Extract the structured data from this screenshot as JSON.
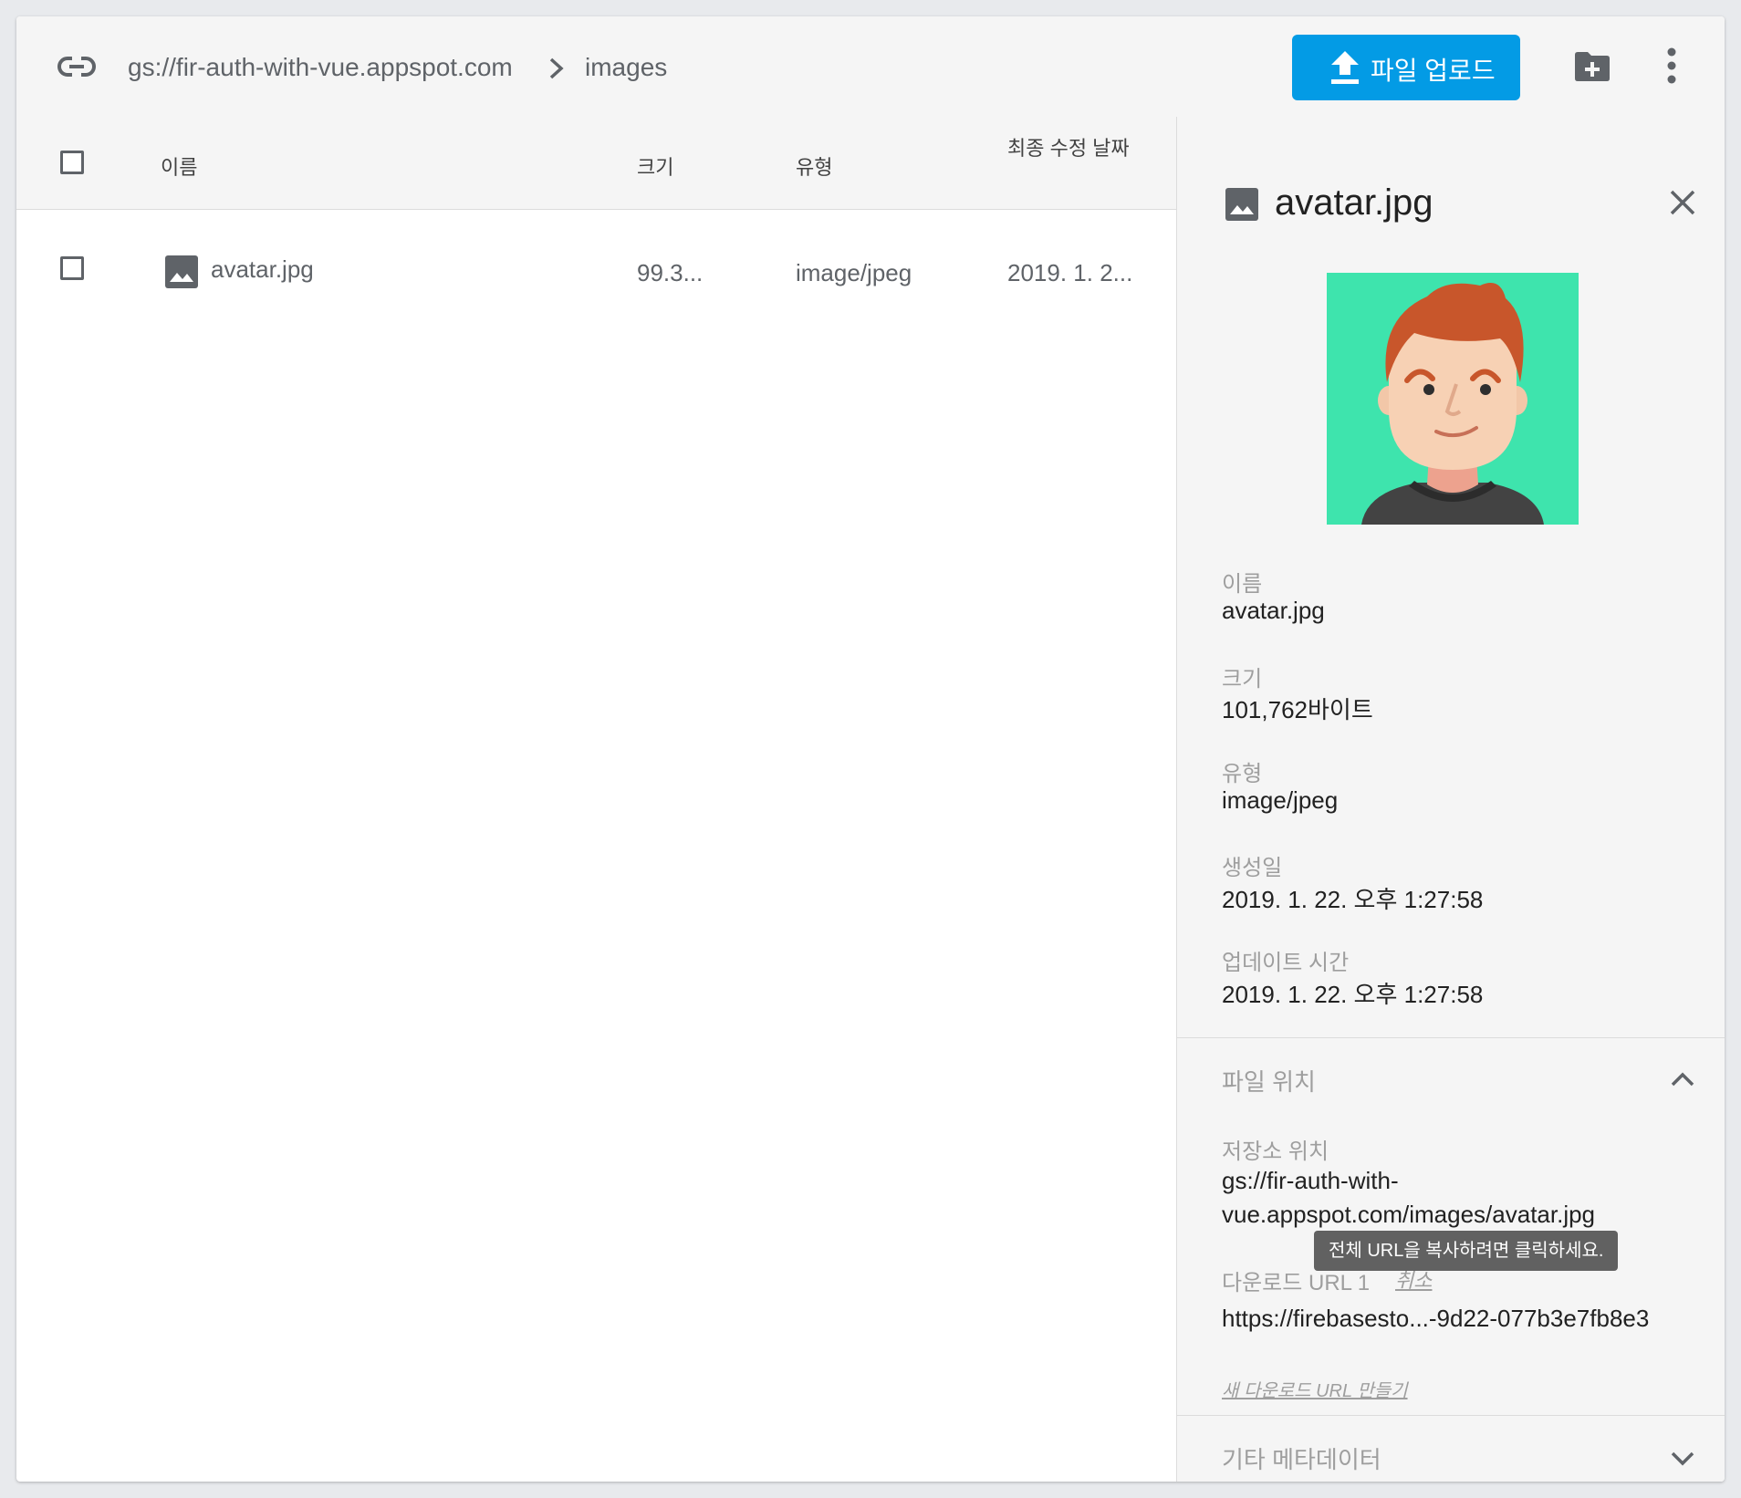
{
  "breadcrumb": {
    "bucket": "gs://fir-auth-with-vue.appspot.com",
    "folder": "images"
  },
  "toolbar": {
    "upload_label": "파일 업로드"
  },
  "table": {
    "columns": {
      "name": "이름",
      "size": "크기",
      "type": "유형",
      "modified": "최종 수정 날짜"
    },
    "rows": [
      {
        "name": "avatar.jpg",
        "size": "99.3...",
        "type": "image/jpeg",
        "modified": "2019. 1. 2..."
      }
    ]
  },
  "details": {
    "title": "avatar.jpg",
    "name_label": "이름",
    "name_value": "avatar.jpg",
    "size_label": "크기",
    "size_value": "101,762바이트",
    "type_label": "유형",
    "type_value": "image/jpeg",
    "created_label": "생성일",
    "created_value": "2019. 1. 22. 오후 1:27:58",
    "updated_label": "업데이트 시간",
    "updated_value": "2019. 1. 22. 오후 1:27:58",
    "location_section": "파일 위치",
    "storage_location_label": "저장소 위치",
    "storage_location_line1": "gs://fir-auth-with-",
    "storage_location_line2": "vue.appspot.com/images/avatar.jpg",
    "download_url_label": "다운로드 URL 1",
    "download_url_cancel": "취소",
    "download_url_value": "https://firebasesto...-9d22-077b3e7fb8e3",
    "new_download_url": "새 다운로드 URL 만들기",
    "tooltip": "전체 URL을 복사하려면 클릭하세요.",
    "metadata_section": "기타 메타데이터"
  },
  "colors": {
    "accent": "#039be5",
    "preview_bg": "#3ee4ad"
  }
}
